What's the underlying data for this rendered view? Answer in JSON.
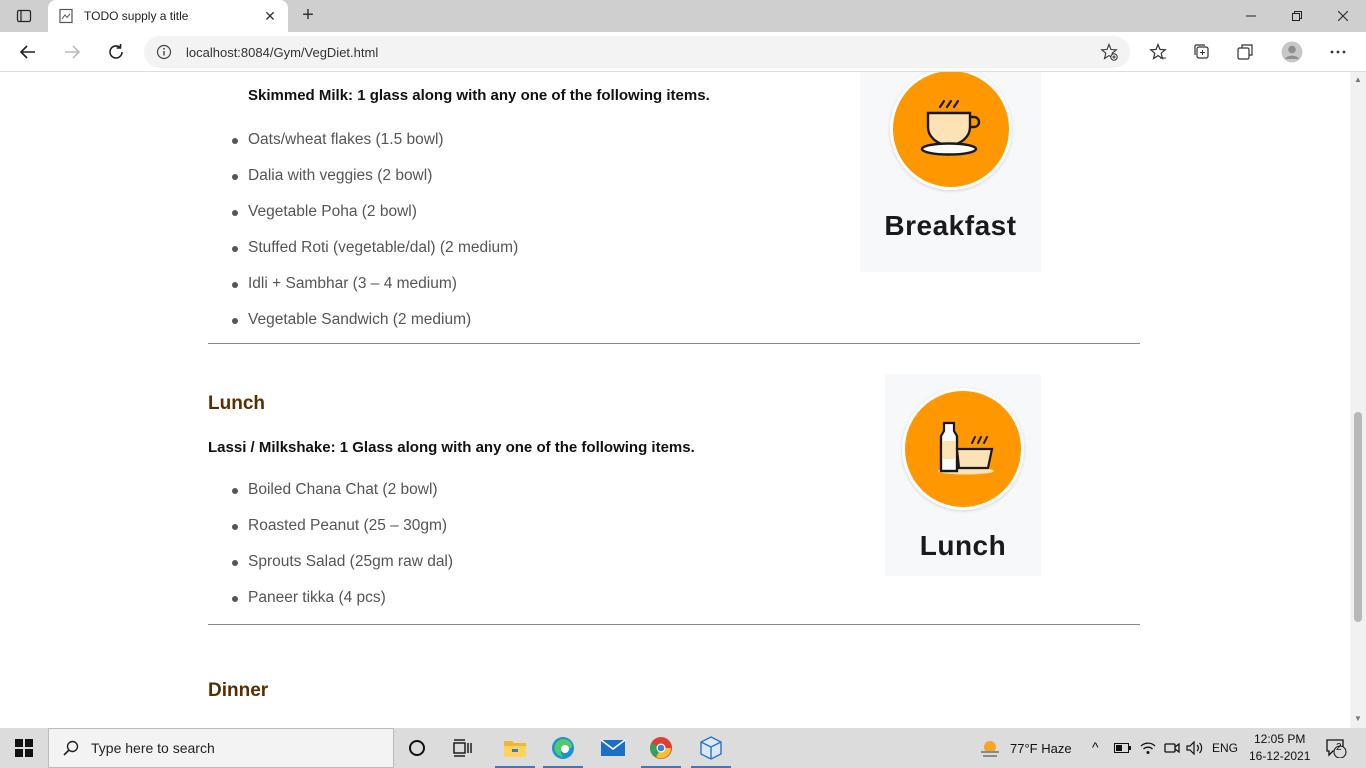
{
  "browser": {
    "tab_title": "TODO supply a title",
    "url": "localhost:8084/Gym/VegDiet.html"
  },
  "breakfast": {
    "lead": "Skimmed Milk: 1 glass along with any one of the following items.",
    "items": [
      "Oats/wheat flakes (1.5 bowl)",
      "Dalia with veggies (2 bowl)",
      "Vegetable Poha (2 bowl)",
      "Stuffed Roti (vegetable/dal) (2 medium)",
      "Idli + Sambhar (3 – 4 medium)",
      "Vegetable Sandwich (2 medium)"
    ],
    "card_label": "Breakfast",
    "card_icon": "coffee-cup-icon"
  },
  "lunch": {
    "title": "Lunch",
    "lead": "Lassi / Milkshake: 1 Glass along with any one of the following items.",
    "items": [
      "Boiled Chana Chat (2 bowl)",
      "Roasted Peanut (25 – 30gm)",
      "Sprouts Salad (25gm raw dal)",
      "Paneer tikka (4 pcs)"
    ],
    "card_label": "Lunch",
    "card_icon": "milk-bottle-bowl-icon"
  },
  "dinner": {
    "title": "Dinner"
  },
  "taskbar": {
    "search_placeholder": "Type here to search",
    "weather": "77°F  Haze",
    "language": "ENG",
    "time": "12:05 PM",
    "date": "16-12-2021",
    "notifications": "2"
  },
  "colors": {
    "accent_orange": "#ff9800",
    "section_title": "#5a2d00",
    "list_text": "#555555"
  }
}
